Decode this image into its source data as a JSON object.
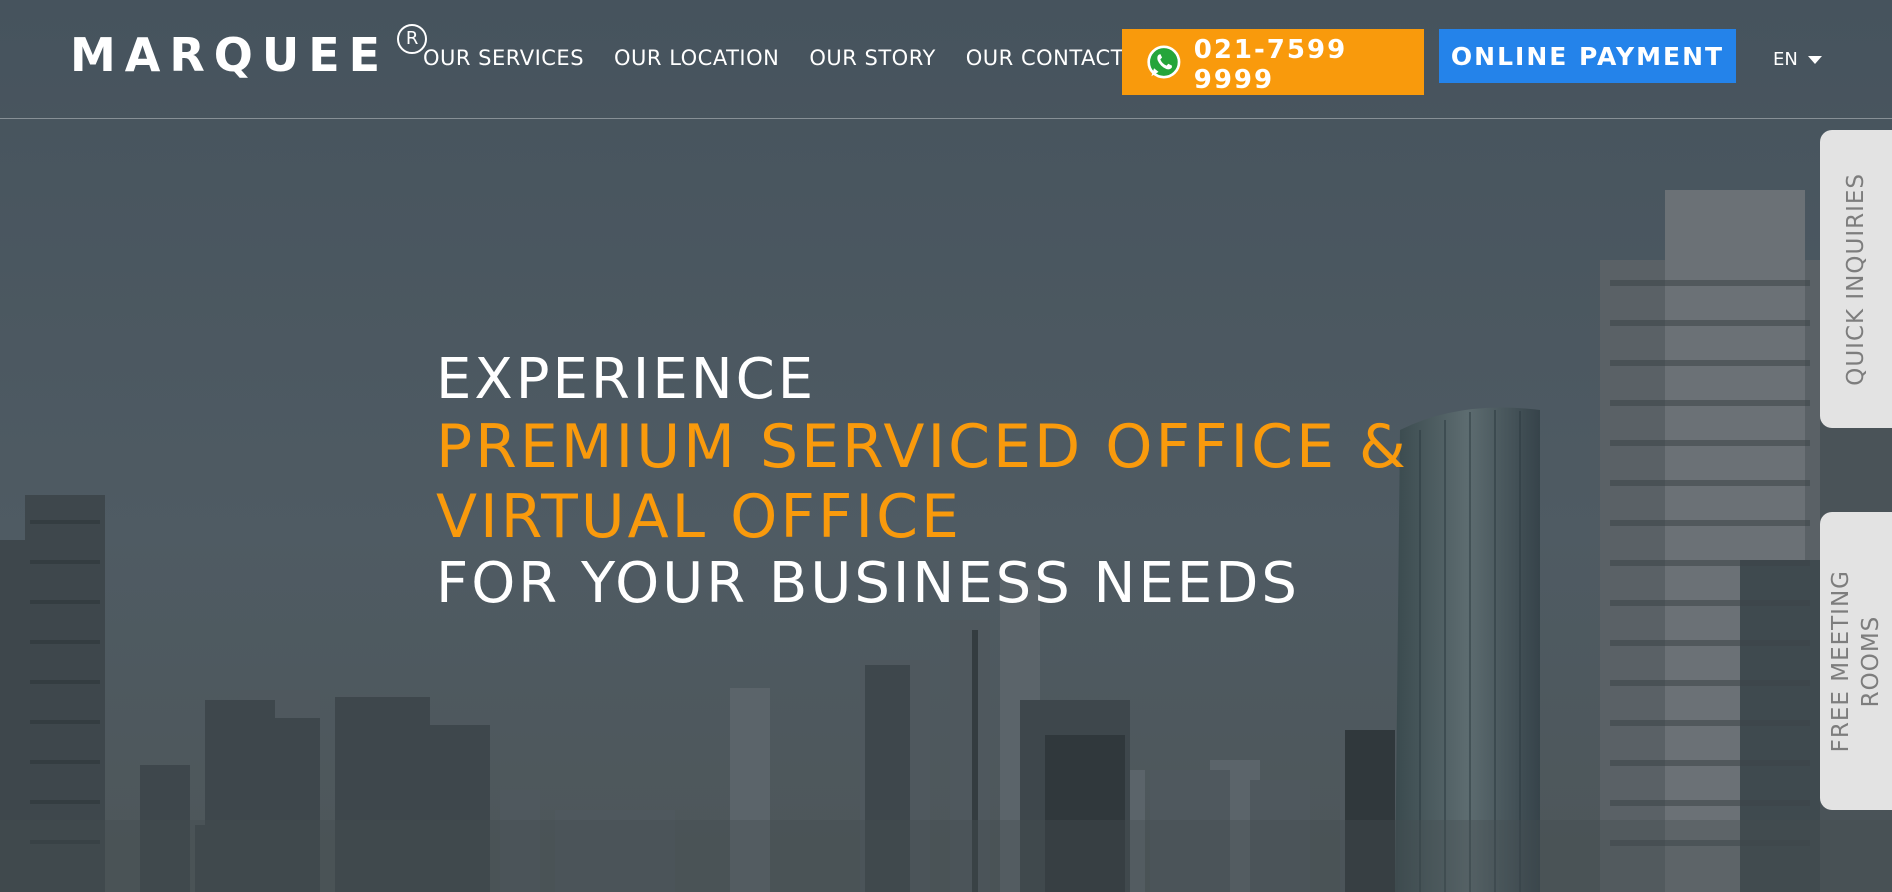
{
  "brand": {
    "name": "MARQUEE",
    "registered_mark": "R"
  },
  "nav": {
    "items": [
      {
        "label": "Our Services"
      },
      {
        "label": "Our Location"
      },
      {
        "label": "Our Story"
      },
      {
        "label": "Our Contact"
      }
    ]
  },
  "header_actions": {
    "phone": {
      "icon": "whatsapp-icon",
      "number": "021-7599 9999"
    },
    "payment_label": "Online Payment",
    "language": "EN"
  },
  "hero": {
    "line1": "EXPERIENCE",
    "highlight_line1": "PREMIUM SERVICED OFFICE &",
    "highlight_line2": "VIRTUAL OFFICE",
    "line4": "FOR YOUR BUSINESS NEEDS"
  },
  "side_tabs": {
    "quick_inquiries": "Quick Inquiries",
    "free_meeting_rooms": "Free Meeting\nRooms"
  },
  "colors": {
    "accent_orange": "#f99a0c",
    "payment_blue": "#2483ea",
    "header_bg": "#44525c",
    "whatsapp_green": "#25a53a",
    "side_tab_bg": "#e3e3e3"
  }
}
